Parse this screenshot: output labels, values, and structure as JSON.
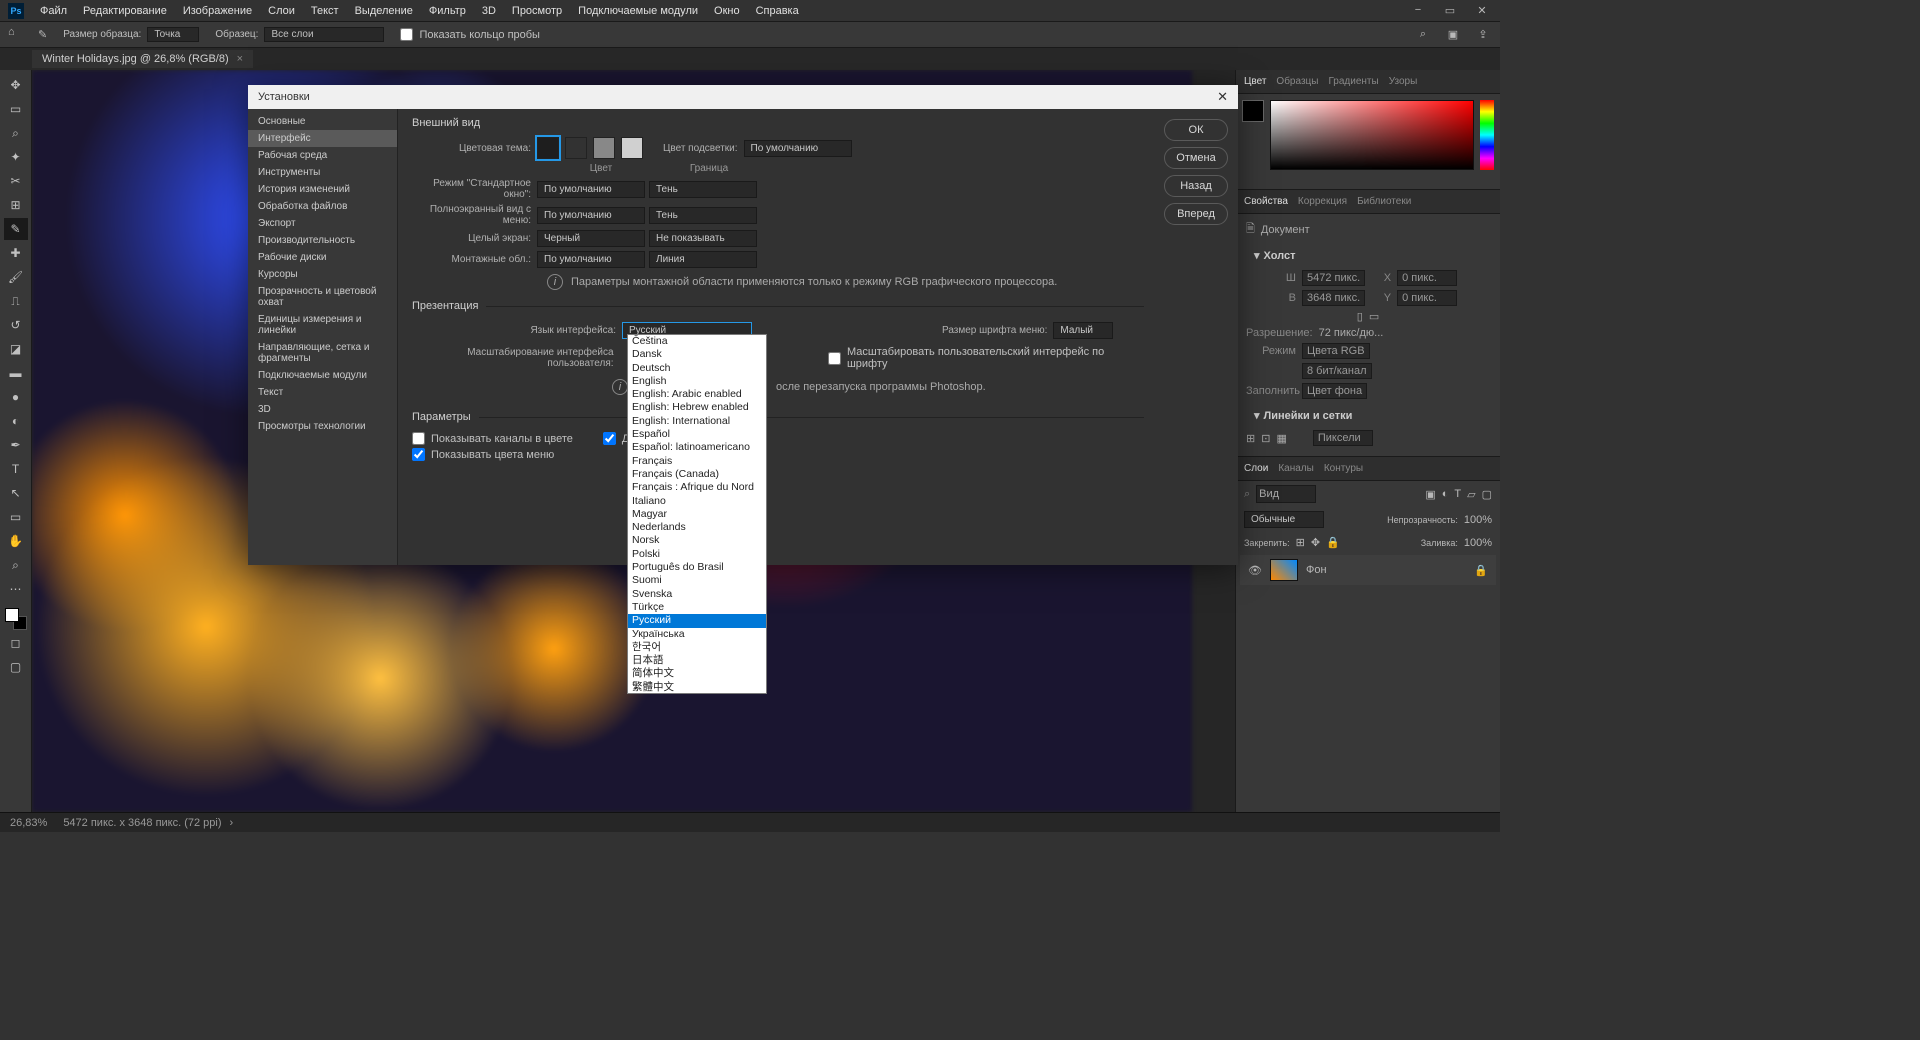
{
  "menu": {
    "items": [
      "Файл",
      "Редактирование",
      "Изображение",
      "Слои",
      "Текст",
      "Выделение",
      "Фильтр",
      "3D",
      "Просмотр",
      "Подключаемые модули",
      "Окно",
      "Справка"
    ]
  },
  "options": {
    "size_label": "Размер образца:",
    "size_value": "Точка",
    "sample_label": "Образец:",
    "sample_value": "Все слои",
    "ring_label": "Показать кольцо пробы"
  },
  "tab": {
    "title": "Winter Holidays.jpg @ 26,8% (RGB/8)"
  },
  "dialog": {
    "title": "Установки",
    "categories": [
      "Основные",
      "Интерфейс",
      "Рабочая среда",
      "Инструменты",
      "История изменений",
      "Обработка файлов",
      "Экспорт",
      "Производительность",
      "Рабочие диски",
      "Курсоры",
      "Прозрачность и цветовой охват",
      "Единицы измерения и линейки",
      "Направляющие, сетка и фрагменты",
      "Подключаемые модули",
      "Текст",
      "3D",
      "Просмотры технологии"
    ],
    "active_category_index": 1,
    "section_appearance": "Внешний вид",
    "color_theme_label": "Цветовая тема:",
    "highlight_label": "Цвет подсветки:",
    "highlight_value": "По умолчанию",
    "col_color": "Цвет",
    "col_border": "Граница",
    "row_standard": "Режим \"Стандартное окно\":",
    "row_fullmenu": "Полноэкранный вид с меню:",
    "row_full": "Целый экран:",
    "row_artboard": "Монтажные обл.:",
    "val_default": "По умолчанию",
    "val_shadow": "Тень",
    "val_black": "Черный",
    "val_none": "Не показывать",
    "val_line": "Линия",
    "info_artboard": "Параметры монтажной области применяются только к режиму RGB графического процессора.",
    "section_presentation": "Презентация",
    "lang_label": "Язык интерфейса:",
    "lang_value": "Русский",
    "fontsize_label": "Размер шрифта меню:",
    "fontsize_value": "Малый",
    "scale_label": "Масштабирование интерфейса пользователя:",
    "scale_checkbox": "Масштабировать пользовательский интерфейс по шрифту",
    "info_restart": "осле перезапуска программы Photoshop.",
    "section_params": "Параметры",
    "cb_channels": "Показывать каналы в цвете",
    "cb_dynamic": "Динамич",
    "cb_menucolors": "Показывать цвета меню",
    "btn_ok": "ОК",
    "btn_cancel": "Отмена",
    "btn_back": "Назад",
    "btn_forward": "Вперед"
  },
  "languages": [
    "Čeština",
    "Dansk",
    "Deutsch",
    "English",
    "English: Arabic enabled",
    "English: Hebrew enabled",
    "English: International",
    "Español",
    "Español: latinoamericano",
    "Français",
    "Français (Canada)",
    "Français : Afrique du Nord",
    "Italiano",
    "Magyar",
    "Nederlands",
    "Norsk",
    "Polski",
    "Português do Brasil",
    "Suomi",
    "Svenska",
    "Türkçe",
    "Русский",
    "Українська",
    "한국어",
    "日本語",
    "简体中文",
    "繁體中文"
  ],
  "lang_selected_index": 21,
  "panels": {
    "color_tabs": [
      "Цвет",
      "Образцы",
      "Градиенты",
      "Узоры"
    ],
    "props_tabs": [
      "Свойства",
      "Коррекция",
      "Библиотеки"
    ],
    "doc_label": "Документ",
    "canvas_hdr": "Холст",
    "w_label": "Ш",
    "w_val": "5472 пикс.",
    "x_label": "X",
    "x_val": "0 пикс.",
    "h_label": "В",
    "h_val": "3648 пикс.",
    "y_label": "Y",
    "y_val": "0 пикс.",
    "res_label": "Разрешение:",
    "res_val": "72 пикс/дю...",
    "mode_label": "Режим",
    "mode_val": "Цвета RGB",
    "bits_val": "8 бит/канал",
    "fill_label": "Заполнить",
    "fill_val": "Цвет фона",
    "rulers_hdr": "Линейки и сетки",
    "rulers_unit": "Пиксели",
    "layers_tabs": [
      "Слои",
      "Каналы",
      "Контуры"
    ],
    "kind_label": "Вид",
    "blend_val": "Обычные",
    "opacity_label": "Непрозрачность:",
    "opacity_val": "100%",
    "lock_label": "Закрепить:",
    "fillop_label": "Заливка:",
    "fillop_val": "100%",
    "layer_name": "Фон"
  },
  "status": {
    "zoom": "26,83%",
    "dims": "5472 пикс. x 3648 пикс. (72 ppi)"
  }
}
